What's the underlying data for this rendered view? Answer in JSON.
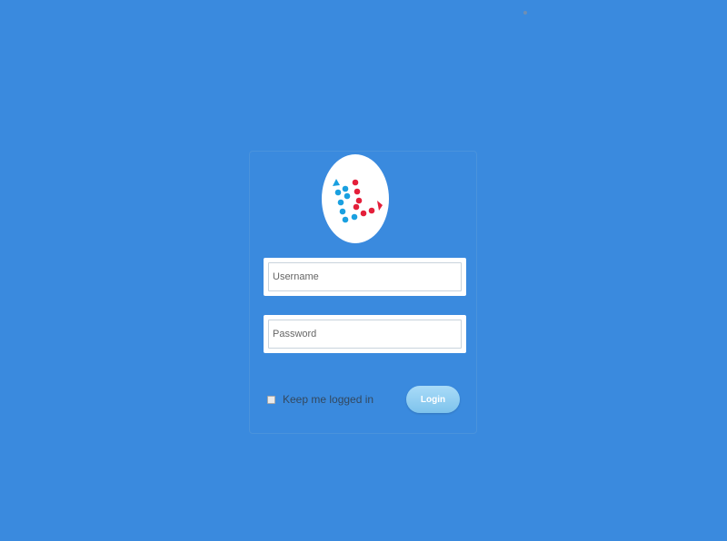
{
  "login": {
    "username_placeholder": "Username",
    "username_value": "",
    "password_placeholder": "Password",
    "password_value": "",
    "remember_label": "Keep me logged in",
    "remember_checked": false,
    "submit_label": "Login"
  },
  "colors": {
    "background": "#3a8ade",
    "logo_blue": "#1aa0e0",
    "logo_red": "#e41f3a",
    "button": "#8fcdf1"
  },
  "icons": {
    "logo": "dotted-arrows-logo"
  }
}
